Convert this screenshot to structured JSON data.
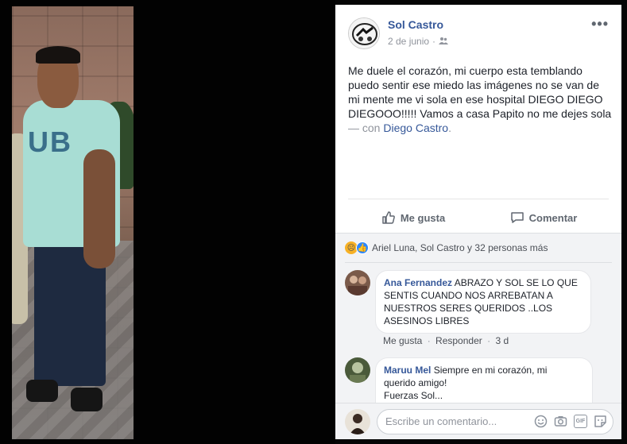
{
  "post": {
    "author": "Sol Castro",
    "date": "2 de junio",
    "date_sep": "·",
    "more_label": "•••",
    "text_main": "Me duele el corazón, mi cuerpo esta temblando puedo sentir ese miedo las imágenes no se van de mi mente me vi sola en ese hospital DIEGO DIEGO DIEGOOO!!!!! Vamos a casa Papito no me dejes sola",
    "with_text": "— con",
    "tagged": "Diego Castro",
    "tagged_suffix": "."
  },
  "actions": {
    "like_label": "Me gusta",
    "comment_label": "Comentar"
  },
  "reactions": {
    "summary": "Ariel Luna, Sol Castro y 32 personas más"
  },
  "comments": [
    {
      "name": "Ana Fernandez",
      "text": "ABRAZO Y SOL SE LO QUE SENTIS CUANDO NOS ARREBATAN A NUESTROS SERES QUERIDOS ..LOS ASESINOS LIBRES",
      "like": "Me gusta",
      "reply": "Responder",
      "time": "3 d"
    },
    {
      "name": "Maruu Mel",
      "text_line1": "Siempre en mi corazón, mi",
      "text_line2": "querido amigo!",
      "text_line3": "Fuerzas Sol..."
    }
  ],
  "composer": {
    "placeholder": "Escribe un comentario..."
  },
  "photo": {
    "shirt_print": "UB"
  },
  "colors": {
    "link": "#365899",
    "meta": "#90949c",
    "like_blue": "#2d88ff"
  }
}
